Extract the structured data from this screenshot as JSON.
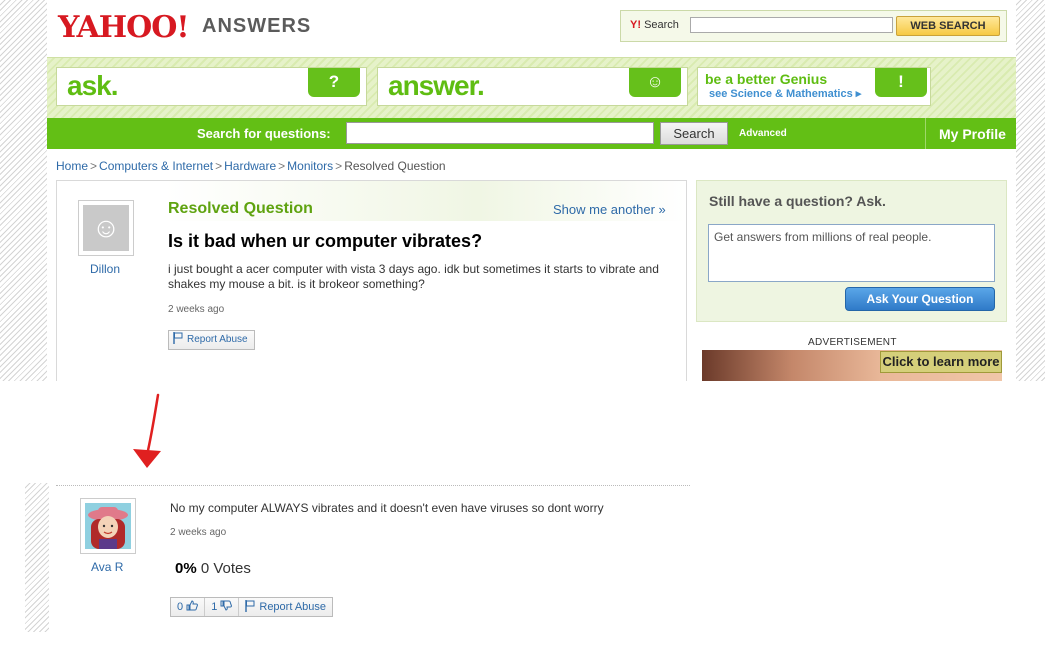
{
  "header": {
    "logo_yahoo": "YAHOO!",
    "logo_answers": "ANSWERS",
    "web_search_label": "Search",
    "web_search_button": "WEB SEARCH"
  },
  "banner": {
    "ask": "ask.",
    "answer": "answer.",
    "genius_title": "be a better Genius",
    "genius_link": "see Science & Mathematics"
  },
  "nav": {
    "search_label": "Search for questions:",
    "search_button": "Search",
    "advanced": "Advanced",
    "my_profile": "My Profile"
  },
  "breadcrumb": {
    "items": [
      "Home",
      "Computers & Internet",
      "Hardware",
      "Monitors"
    ],
    "current": "Resolved Question"
  },
  "question": {
    "status": "Resolved Question",
    "show_another": "Show me another »",
    "asker": "Dillon",
    "title": "Is it bad when ur computer vibrates?",
    "body": "i just bought a acer computer with vista 3 days ago. idk but sometimes it starts to vibrate and shakes my mouse a bit. is it brokeor something?",
    "age": "2 weeks ago",
    "report_abuse": "Report Abuse"
  },
  "sidebar": {
    "title": "Still have a question? Ask.",
    "textarea_placeholder": "Get answers from millions of real people.",
    "ask_button": "Ask Your Question",
    "ad_label": "ADVERTISEMENT",
    "ad_cta": "Click to learn more"
  },
  "answer": {
    "author": "Ava R",
    "text": "No my computer ALWAYS vibrates and it doesn't even have viruses so dont worry",
    "age": "2 weeks ago",
    "vote_percent": "0%",
    "vote_count": "0 Votes",
    "thumbs_up": "0",
    "thumbs_down": "1",
    "report_abuse": "Report Abuse"
  },
  "colors": {
    "brand_green": "#63bf15",
    "link_blue": "#2e6aa8",
    "yahoo_red": "#d71921",
    "arrow_red": "#e02020"
  }
}
